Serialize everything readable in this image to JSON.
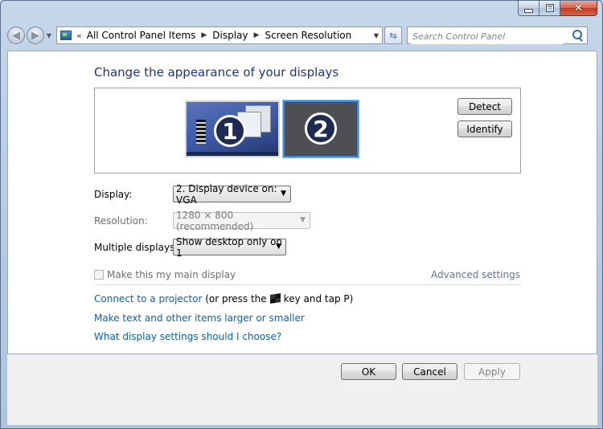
{
  "window": {
    "minimize_label": "minimize",
    "maximize_label": "maximize",
    "close_label": "close"
  },
  "navbar": {
    "breadcrumb": [
      "All Control Panel Items",
      "Display",
      "Screen Resolution"
    ],
    "overflow_chevron": "«",
    "search_placeholder": "Search Control Panel"
  },
  "main": {
    "title": "Change the appearance of your displays",
    "monitors": [
      {
        "number": "1",
        "selected": false
      },
      {
        "number": "2",
        "selected": true
      }
    ],
    "detect_button": "Detect",
    "identify_button": "Identify",
    "display_label": "Display:",
    "display_value": "2. Display device on: VGA",
    "resolution_label": "Resolution:",
    "resolution_value": "1280 × 800 (recommended)",
    "multiple_label": "Multiple displays:",
    "multiple_value": "Show desktop only on 1",
    "main_display_checkbox": "Make this my main display",
    "main_display_checked": false,
    "advanced_settings": "Advanced settings",
    "projector_link": "Connect to a projector",
    "projector_text_before": "(or press the",
    "projector_text_after": "key and tap P)",
    "text_size_link": "Make text and other items larger or smaller",
    "help_link": "What display settings should I choose?"
  },
  "footer": {
    "ok": "OK",
    "cancel": "Cancel",
    "apply": "Apply"
  },
  "colors": {
    "title": "#1e3287",
    "link": "#0b5fb5",
    "selected_monitor_border": "#3a89e0"
  }
}
